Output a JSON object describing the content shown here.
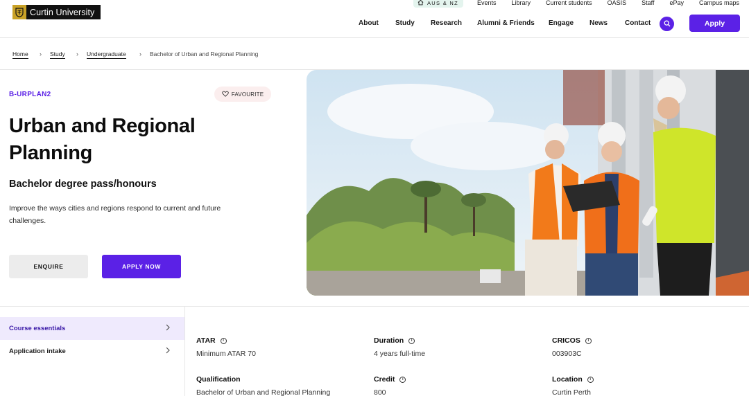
{
  "brand": {
    "name": "Curtin University",
    "accent": "#5b21e6",
    "crest_color": "#c9a227"
  },
  "utility_nav": {
    "region": "AUS & NZ",
    "links": [
      "Events",
      "Library",
      "Current students",
      "OASIS",
      "Staff",
      "ePay",
      "Campus maps"
    ]
  },
  "main_nav": {
    "items": [
      "About",
      "Study",
      "Research",
      "Alumni & Friends",
      "Engage",
      "News",
      "Contact"
    ],
    "search_icon": "search-icon",
    "apply_label": "Apply"
  },
  "breadcrumb": {
    "items": [
      "Home",
      "Study",
      "Undergraduate",
      "Bachelor of Urban and Regional Planning"
    ]
  },
  "hero": {
    "code": "B-URPLAN2",
    "favourite_label": "FAVOURITE",
    "title": "Urban and Regional Planning",
    "subtitle": "Bachelor degree pass/honours",
    "description": "Improve the ways cities and regions respond to current and future challenges.",
    "enquire_label": "ENQUIRE",
    "apply_label": "APPLY NOW"
  },
  "sidebar": {
    "items": [
      {
        "label": "Course essentials",
        "active": true
      },
      {
        "label": "Application intake",
        "active": false
      }
    ]
  },
  "facts": [
    {
      "label": "ATAR",
      "value": "Minimum ATAR 70"
    },
    {
      "label": "Duration",
      "value": "4 years full-time"
    },
    {
      "label": "CRICOS",
      "value": "003903C"
    },
    {
      "label": "Qualification",
      "value": "Bachelor of Urban and Regional Planning"
    },
    {
      "label": "Credit",
      "value": "800"
    },
    {
      "label": "Location",
      "value": "Curtin Perth"
    }
  ]
}
